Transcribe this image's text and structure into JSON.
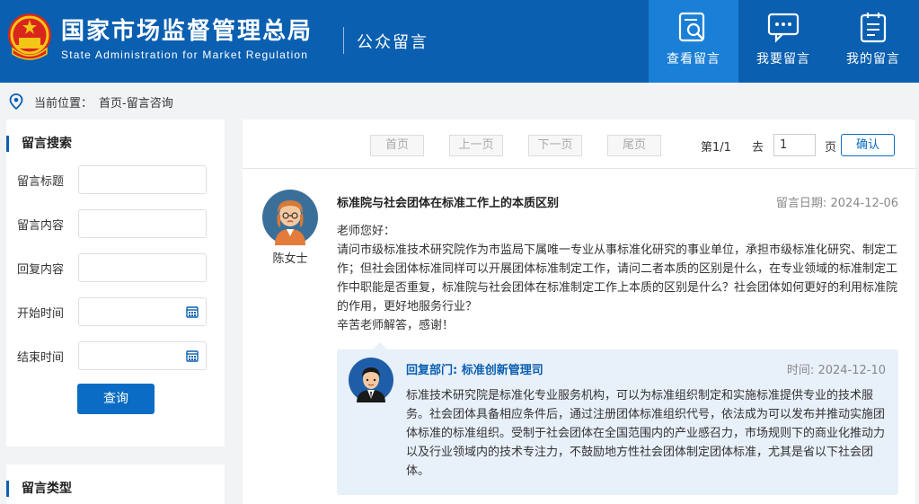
{
  "header": {
    "title_cn": "国家市场监督管理总局",
    "title_en": "State Administration for Market Regulation",
    "subtitle": "公众留言",
    "colors": {
      "header_bg": "#0a5fb0",
      "active_bg": "#1a7fd6"
    },
    "nav": [
      {
        "label": "查看留言",
        "icon": "search-document-icon",
        "active": true
      },
      {
        "label": "我要留言",
        "icon": "chat-bubble-icon",
        "active": false
      },
      {
        "label": "我的留言",
        "icon": "notepad-icon",
        "active": false
      }
    ]
  },
  "breadcrumb": {
    "label": "当前位置：",
    "path": "首页-留言咨询"
  },
  "sidebar": {
    "search_title": "留言搜索",
    "fields": [
      {
        "label": "留言标题",
        "value": ""
      },
      {
        "label": "留言内容",
        "value": ""
      },
      {
        "label": "回复内容",
        "value": ""
      },
      {
        "label": "开始时间",
        "value": ""
      },
      {
        "label": "结束时间",
        "value": ""
      }
    ],
    "query_button": "查询",
    "type_title": "留言类型"
  },
  "pager": {
    "first": "首页",
    "prev": "上一页",
    "next": "下一页",
    "last": "尾页",
    "page_info": "第1/1",
    "goto_prefix": "去",
    "goto_value": "1",
    "goto_suffix": "页",
    "confirm": "确认"
  },
  "message": {
    "asker": "陈女士",
    "title": "标准院与社会团体在标准工作上的本质区别",
    "date_label": "留言日期:",
    "date": "2024-12-06",
    "greeting": "老师您好：",
    "body": "请问市级标准技术研究院作为市监局下属唯一专业从事标准化研究的事业单位，承担市级标准化研究、制定工作；但社会团体标准同样可以开展团体标准制定工作，请问二者本质的区别是什么，在专业领域的标准制定工作中职能是否重复，标准院与社会团体在标准制定工作上本质的区别是什么？社会团体如何更好的利用标准院的作用，更好地服务行业？",
    "closing": "辛苦老师解答，感谢！"
  },
  "reply": {
    "dept_label": "回复部门:",
    "dept": "标准创新管理司",
    "date_label": "时间:",
    "date": "2024-12-10",
    "body": "标准技术研究院是标准化专业服务机构，可以为标准组织制定和实施标准提供专业的技术服务。社会团体具备相应条件后，通过注册团体标准组织代号，依法成为可以发布并推动实施团体标准的标准组织。受制于社会团体在全国范围内的产业感召力，市场规则下的商业化推动力以及行业领域内的技术专注力，不鼓励地方性社会团体制定团体标准，尤其是省以下社会团体。"
  }
}
